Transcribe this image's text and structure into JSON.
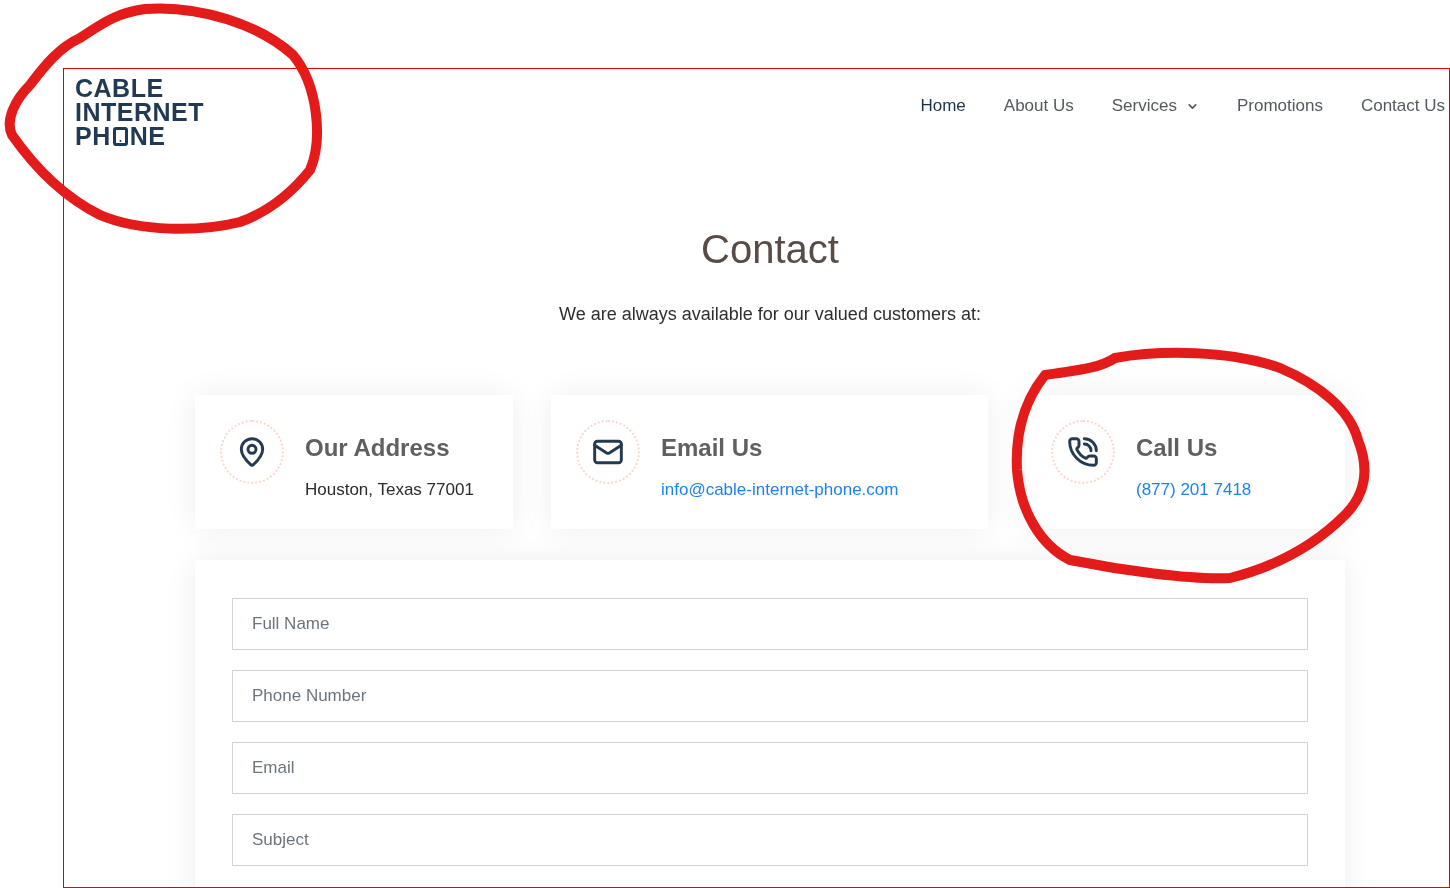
{
  "header": {
    "logo": {
      "lines": [
        "CABLE",
        "INTERNET"
      ],
      "last_line": [
        "PH",
        "NE"
      ]
    },
    "nav": [
      {
        "label": "Home",
        "selected": true,
        "has_menu": false
      },
      {
        "label": "About Us",
        "selected": false,
        "has_menu": false
      },
      {
        "label": "Services",
        "selected": false,
        "has_menu": true
      },
      {
        "label": "Promotions",
        "selected": false,
        "has_menu": false
      },
      {
        "label": "Contact Us",
        "selected": false,
        "has_menu": false
      }
    ]
  },
  "page": {
    "title": "Contact",
    "subtitle": "We are always available for our valued customers at:"
  },
  "contact_cards": [
    {
      "kind": "address",
      "title": "Our Address",
      "value": "Houston, Texas 77001",
      "link": false
    },
    {
      "kind": "email",
      "title": "Email Us",
      "value": "info@cable-internet-phone.com",
      "link": true
    },
    {
      "kind": "phone",
      "title": "Call Us",
      "value": "(877) 201 7418",
      "link": true
    }
  ],
  "form": {
    "fields": [
      {
        "placeholder": "Full Name"
      },
      {
        "placeholder": "Phone Number"
      },
      {
        "placeholder": "Email"
      },
      {
        "placeholder": "Subject"
      }
    ]
  }
}
